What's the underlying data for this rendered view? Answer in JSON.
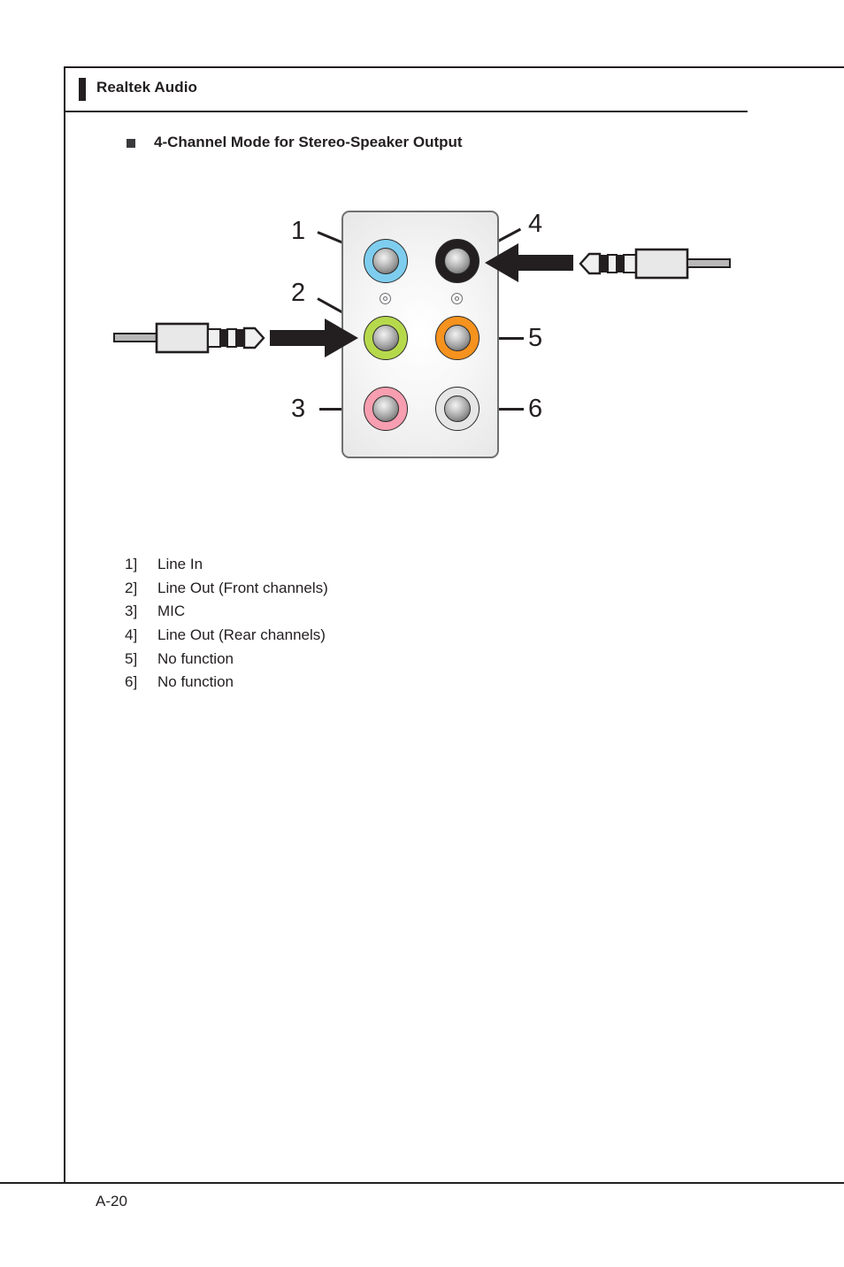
{
  "header": {
    "title": "Realtek Audio"
  },
  "section": {
    "bullet_label": "4-Channel Mode for Stereo-Speaker Output"
  },
  "diagram": {
    "name": "rear-audio-panel-4-channel",
    "panel_color": "#e4e4e4",
    "ports": [
      {
        "number": "1",
        "ring_color": "#7ecdee",
        "label": "Line In",
        "row": 0,
        "col": 0
      },
      {
        "number": "2",
        "ring_color": "#b6d94c",
        "label": "Line Out (Front channels)",
        "row": 1,
        "col": 0
      },
      {
        "number": "3",
        "ring_color": "#f79eb0",
        "label": "MIC",
        "row": 2,
        "col": 0
      },
      {
        "number": "4",
        "ring_color": "#231f20",
        "label": "Line Out (Rear channels)",
        "row": 0,
        "col": 1
      },
      {
        "number": "5",
        "ring_color": "#f6921e",
        "label": "No function",
        "row": 1,
        "col": 1
      },
      {
        "number": "6",
        "ring_color": "#e6e6e6",
        "label": "No function",
        "row": 2,
        "col": 1
      }
    ],
    "callout_numbers": [
      "1",
      "2",
      "3",
      "4",
      "5",
      "6"
    ],
    "arrows": [
      {
        "name": "arrow-into-rear-line-out",
        "direction": "left",
        "target_port": "4"
      },
      {
        "name": "arrow-into-front-line-out",
        "direction": "right",
        "target_port": "2"
      }
    ],
    "connectors": [
      {
        "name": "audio-plug-right",
        "orientation": "tip-left"
      },
      {
        "name": "audio-plug-left",
        "orientation": "tip-right"
      }
    ]
  },
  "legend": {
    "rows": [
      {
        "index": "1]",
        "text": "Line In"
      },
      {
        "index": "2]",
        "text": "Line Out (Front channels)"
      },
      {
        "index": "3]",
        "text": "MIC"
      },
      {
        "index": "4]",
        "text": "Line Out (Rear channels)"
      },
      {
        "index": "5]",
        "text": "No function"
      },
      {
        "index": "6]",
        "text": "No function"
      }
    ]
  },
  "footer": {
    "page_number": "A-20"
  }
}
